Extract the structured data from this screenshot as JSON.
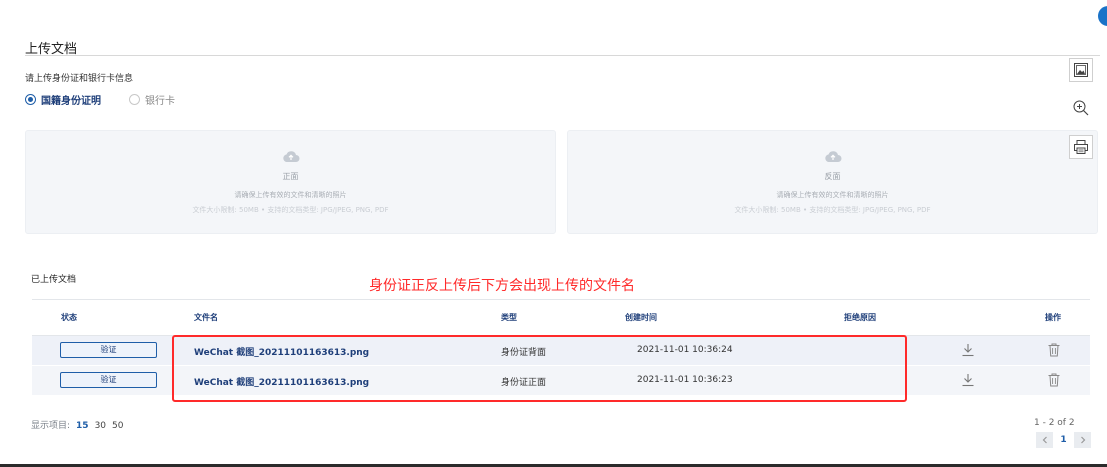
{
  "section": {
    "title": "上传文档",
    "prompt": "请上传身份证和银行卡信息"
  },
  "doc_type": {
    "options": [
      {
        "label": "国籍身份证明",
        "selected": true
      },
      {
        "label": "银行卡",
        "selected": false
      }
    ]
  },
  "upload": {
    "front": {
      "side": "正面",
      "hint": "请确保上传有效的文件和清晰的照片",
      "spec": "文件大小限制: 50MB • 支持的文档类型: JPG/JPEG, PNG, PDF"
    },
    "back": {
      "side": "反面",
      "hint": "请确保上传有效的文件和清晰的照片",
      "spec": "文件大小限制: 50MB • 支持的文档类型: JPG/JPEG, PNG, PDF"
    }
  },
  "toolbar": {
    "icons": [
      "image-frame-icon",
      "zoom-in-icon",
      "print-icon"
    ]
  },
  "uploaded": {
    "title": "已上传文档",
    "annotation": "身份证正反上传后下方会出现上传的文件名",
    "columns": {
      "status": "状态",
      "filename": "文件名",
      "type": "类型",
      "created": "创建时间",
      "reject": "拒绝原因",
      "actions": "操作"
    },
    "rows": [
      {
        "status_button": "验证",
        "filename": "WeChat 截图_20211101163613.png",
        "type": "身份证背面",
        "created": "2021-11-01 10:36:24",
        "reject": ""
      },
      {
        "status_button": "验证",
        "filename": "WeChat 截图_20211101163613.png",
        "type": "身份证正面",
        "created": "2021-11-01 10:36:23",
        "reject": ""
      }
    ]
  },
  "pagination": {
    "label": "显示项目:",
    "sizes": [
      "15",
      "30",
      "50"
    ],
    "selected_size": "15",
    "range": "1 - 2 of 2",
    "current_page": "1"
  },
  "colors": {
    "accent": "#1f5ea8",
    "annotation": "#ff2a2a"
  }
}
